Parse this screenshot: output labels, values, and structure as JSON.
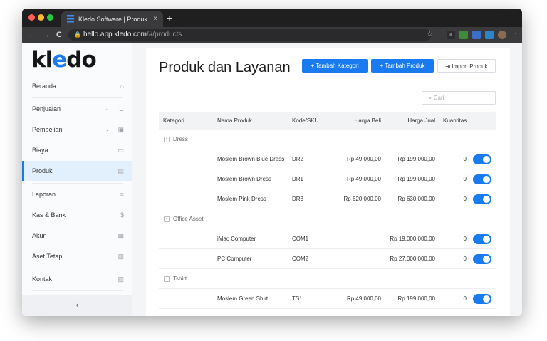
{
  "browser": {
    "tab_title": "Kledo Software | Produk",
    "tab_close": "×",
    "new_tab": "+",
    "url_host": "hello.app.kledo.com",
    "url_path": "/#/products",
    "back": "←",
    "forward": "→",
    "reload": "C",
    "bookmark": "☆",
    "menu": "⋮"
  },
  "sidebar": {
    "logo_k": "kl",
    "logo_e": "e",
    "logo_do": "do",
    "items": [
      {
        "label": "Beranda",
        "icon": "home-icon",
        "glyph": "⌂"
      },
      {
        "label": "Penjualan",
        "icon": "basket-icon",
        "glyph": "⊔",
        "chevron": "⌄"
      },
      {
        "label": "Pembelian",
        "icon": "bag-icon",
        "glyph": "▣",
        "chevron": "⌄"
      },
      {
        "label": "Biaya",
        "icon": "card-icon",
        "glyph": "▭"
      },
      {
        "label": "Produk",
        "icon": "box-icon",
        "glyph": "▤"
      },
      {
        "label": "Laporan",
        "icon": "chart-icon",
        "glyph": "⌗"
      },
      {
        "label": "Kas & Bank",
        "icon": "dollar-icon",
        "glyph": "$"
      },
      {
        "label": "Akun",
        "icon": "book-icon",
        "glyph": "▦"
      },
      {
        "label": "Aset Tetap",
        "icon": "building-icon",
        "glyph": "▥"
      },
      {
        "label": "Kontak",
        "icon": "contact-card-icon",
        "glyph": "▨"
      }
    ],
    "collapse": "‹"
  },
  "page": {
    "title": "Produk dan Layanan",
    "btn_kategori": "+ Tambah Kategori",
    "btn_produk": "+ Tambah Produk",
    "btn_import": "Import Produk",
    "search_placeholder": "Cari"
  },
  "table": {
    "headers": [
      "Kategori",
      "Nama Produk",
      "Kode/SKU",
      "Harga Beli",
      "Harga Jual",
      "Kuantitas"
    ],
    "groups": [
      {
        "name": "Dress",
        "toggle": "-",
        "rows": [
          {
            "name": "Moslem Brown Blue Dress",
            "sku": "DR2",
            "beli": "Rp 49.000,00",
            "jual": "Rp 199.000,00",
            "qty": "0",
            "active": true
          },
          {
            "name": "Moslem Brown Dress",
            "sku": "DR1",
            "beli": "Rp 49.000,00",
            "jual": "Rp 199.000,00",
            "qty": "0",
            "active": true
          },
          {
            "name": "Moslem Pink Dress",
            "sku": "DR3",
            "beli": "Rp 620.000,00",
            "jual": "Rp 630.000,00",
            "qty": "0",
            "active": true
          }
        ]
      },
      {
        "name": "Office Asset",
        "toggle": "-",
        "rows": [
          {
            "name": "iMac Computer",
            "sku": "COM1",
            "beli": "",
            "jual": "Rp 19.000.000,00",
            "qty": "0",
            "active": true
          },
          {
            "name": "PC Computer",
            "sku": "COM2",
            "beli": "",
            "jual": "Rp 27.000.000,00",
            "qty": "0",
            "active": true
          }
        ]
      },
      {
        "name": "Tshirt",
        "toggle": "-",
        "rows": [
          {
            "name": "Moslem Green Shirt",
            "sku": "TS1",
            "beli": "Rp 49.000,00",
            "jual": "Rp 199.000,00",
            "qty": "0",
            "active": true
          }
        ]
      }
    ]
  },
  "colors": {
    "accent": "#1a7bf0",
    "active_bg": "#e2effc"
  }
}
